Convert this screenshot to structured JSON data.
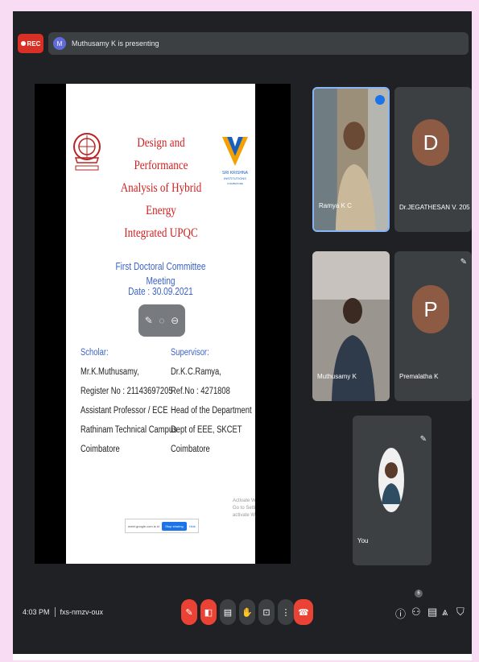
{
  "topbar": {
    "rec_label": "REC",
    "presenter_initial": "M",
    "presenting_text": "Muthusamy K is presenting"
  },
  "slide": {
    "title_lines": [
      "Design and Performance",
      "Analysis of Hybrid Energy",
      "Integrated UPQC"
    ],
    "right_logo_text": [
      "SRI KRISHNA",
      "INSTITUTIONS",
      "COIMBATORE"
    ],
    "meeting": "First Doctoral Committee Meeting",
    "date": "Date : 30.09.2021",
    "scholar": {
      "heading": "Scholar:",
      "lines": [
        "Mr.K.Muthusamy,",
        "Register No : 21143697205",
        "Assistant Professor / ECE",
        "Rathinam Technical Campus",
        "Coimbatore"
      ]
    },
    "supervisor": {
      "heading": "Supervisor:",
      "lines": [
        "Dr.K.C.Ramya,",
        "Ref.No : 4271808",
        "Head of the Department",
        "Dept of EEE, SKCET",
        "Coimbatore"
      ]
    },
    "watermark": [
      "Activate Windows",
      "Go to Settings to activate Windows."
    ],
    "banner": {
      "text": "meet.google.com is sharing your screen.",
      "stop_label": "Stop sharing",
      "hide_label": "Hide"
    }
  },
  "participants": [
    {
      "name": "Ramya K C",
      "type": "video"
    },
    {
      "name": "Dr.JEGATHESAN V. 205",
      "type": "avatar",
      "initial": "D",
      "color": "#8d5a43"
    },
    {
      "name": "Muthusamy K",
      "type": "video"
    },
    {
      "name": "Premalatha K",
      "type": "avatar",
      "initial": "P",
      "color": "#8d5a43"
    },
    {
      "name": "You",
      "type": "video"
    }
  ],
  "bottombar": {
    "time": "4:03 PM",
    "meeting_code": "fxs-nmzv-oux",
    "people_count": "6"
  },
  "colors": {
    "end_call": "#ea4335",
    "background": "#202124",
    "page": "#f8dcf4"
  }
}
